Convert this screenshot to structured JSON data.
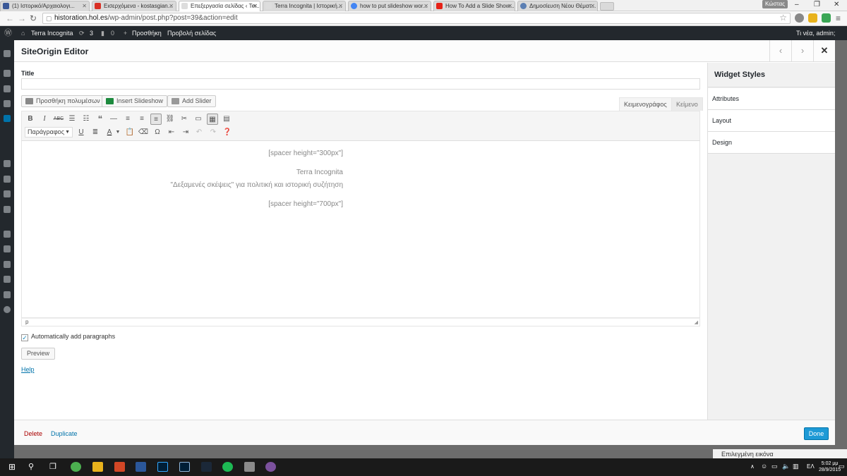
{
  "browser": {
    "tabs": [
      {
        "label": "(1) Ιστορικό/Αρχαιολογι...",
        "color": "#3b5998"
      },
      {
        "label": "Εισερχόμενα - kostasgian...",
        "color": "#d93025"
      },
      {
        "label": "Επεξεργασία σελίδας ‹ Ter...",
        "color": "#9aa0a6"
      },
      {
        "label": "Terra Incognita | Ιστορική...",
        "color": "#9aa0a6"
      },
      {
        "label": "how to put slideshow wor...",
        "color": "#4285f4"
      },
      {
        "label": "How To Add a Slide Show...",
        "color": "#e62117"
      },
      {
        "label": "Δημοσίευση Νέου Θέματ...",
        "color": "#5b7fb3"
      }
    ],
    "user_badge": "Κώστας",
    "url_host": "historation.hol.es",
    "url_path": "/wp-admin/post.php?post=39&action=edit"
  },
  "adminbar": {
    "site_name": "Terra Incognita",
    "updates_count": "3",
    "comments_count": "0",
    "new_label": "Προσθήκη",
    "view_label": "Προβολή σελίδας",
    "greeting": "Τι νέα, admin;"
  },
  "modal": {
    "title": "SiteOrigin Editor",
    "field_title_label": "Title",
    "add_media_label": "Προσθήκη πολυμέσων",
    "insert_slideshow_label": "Insert Slideshow",
    "add_slider_label": "Add Slider",
    "tab_visual": "Κειμενογράφος",
    "tab_text": "Κείμενο",
    "format_select": "Παράγραφος",
    "editor_lines": [
      "[spacer height=\"300px\"]",
      "Terra Incognita",
      "\"Δεξαμενές σκέψεις\" για πολιτική και ιστορική συζήτηση",
      "[spacer height=\"700px\"]"
    ],
    "status_path": "p",
    "auto_paragraphs_label": "Automatically add paragraphs",
    "preview_label": "Preview",
    "help_label": "Help",
    "side_title": "Widget Styles",
    "side_sections": [
      "Attributes",
      "Layout",
      "Design"
    ],
    "delete_label": "Delete",
    "duplicate_label": "Duplicate",
    "done_label": "Done"
  },
  "below_modal": "Επιλεγμένη εικόνα",
  "taskbar": {
    "lang": "ΕΛ",
    "time": "5:02 μμ",
    "date": "28/9/2015"
  },
  "colors": {
    "accent": "#1e9ad6",
    "delete": "#aa0000",
    "link": "#0073aa",
    "adminbar": "#23282d"
  }
}
